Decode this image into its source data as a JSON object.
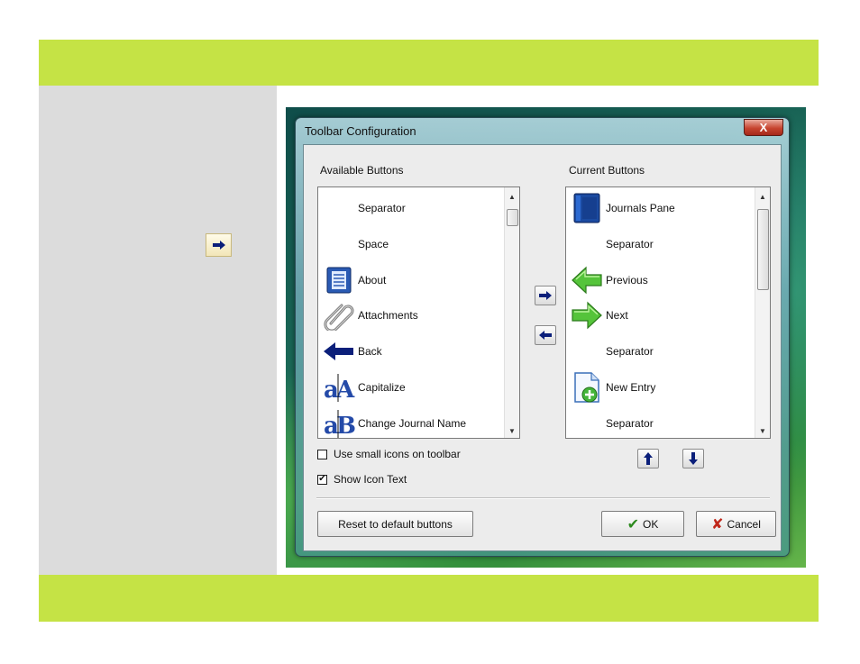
{
  "side": {
    "arrow_icon": "right-arrow-icon"
  },
  "dialog": {
    "title": "Toolbar Configuration",
    "close_label": "X",
    "available_label": "Available Buttons",
    "current_label": "Current Buttons",
    "available_items": [
      {
        "label": "Separator",
        "icon": "none"
      },
      {
        "label": "Space",
        "icon": "none"
      },
      {
        "label": "About",
        "icon": "about-icon"
      },
      {
        "label": "Attachments",
        "icon": "paperclip-icon"
      },
      {
        "label": "Back",
        "icon": "back-arrow-icon"
      },
      {
        "label": "Capitalize",
        "icon": "capitalize-icon"
      },
      {
        "label": "Change Journal Name",
        "icon": "change-name-icon"
      }
    ],
    "current_items": [
      {
        "label": "Journals Pane",
        "icon": "journal-book-icon"
      },
      {
        "label": "Separator",
        "icon": "none"
      },
      {
        "label": "Previous",
        "icon": "previous-arrow-icon"
      },
      {
        "label": "Next",
        "icon": "next-arrow-icon"
      },
      {
        "label": "Separator",
        "icon": "none"
      },
      {
        "label": "New Entry",
        "icon": "new-entry-icon"
      },
      {
        "label": "Separator",
        "icon": "none"
      }
    ],
    "small_icons_label": "Use small icons on toolbar",
    "small_icons_checked": false,
    "show_icon_text_label": "Show Icon Text",
    "show_icon_text_checked": true,
    "reset_label": "Reset to default buttons",
    "ok_label": "OK",
    "cancel_label": "Cancel"
  },
  "colors": {
    "band": "#c5e345",
    "panel": "#dcdcdc",
    "arrow_blue": "#0b1f7a"
  }
}
